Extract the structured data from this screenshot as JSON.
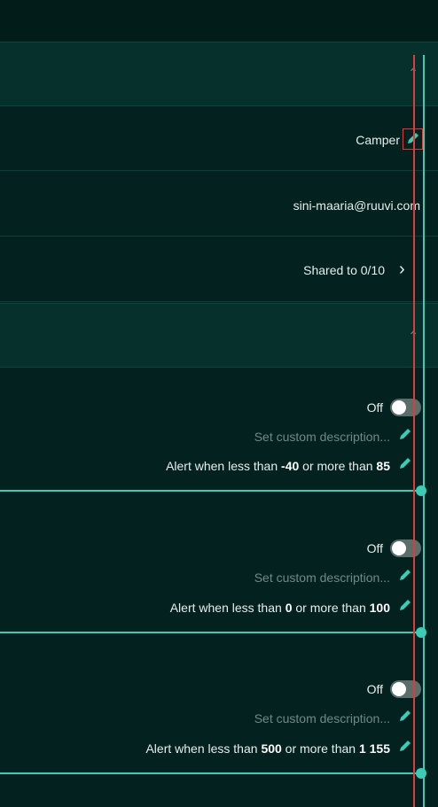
{
  "sensor": {
    "name": "Camper",
    "owner": "sini-maaria@ruuvi.com",
    "share_label": "Shared to 0/10",
    "chevron_up": "⌃",
    "chevron_right": "›"
  },
  "alerts": [
    {
      "state_label": "Off",
      "description_placeholder": "Set custom description...",
      "range_prefix": "Alert when less than ",
      "min": "-40",
      "range_mid": " or more than ",
      "max": "85"
    },
    {
      "state_label": "Off",
      "description_placeholder": "Set custom description...",
      "range_prefix": "Alert when less than ",
      "min": "0",
      "range_mid": " or more than ",
      "max": "100"
    },
    {
      "state_label": "Off",
      "description_placeholder": "Set custom description...",
      "range_prefix": "Alert when less than ",
      "min": "500",
      "range_mid": " or more than ",
      "max": "1 155"
    }
  ],
  "colors": {
    "background": "#03221f",
    "accent": "#3ccbb4",
    "highlight": "#e03a3a"
  }
}
